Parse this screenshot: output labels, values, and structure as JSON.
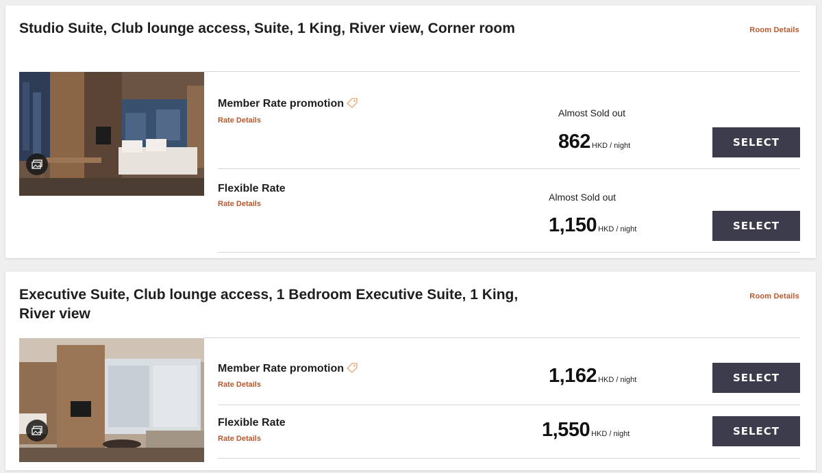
{
  "rooms": [
    {
      "title": "Studio Suite, Club lounge access, Suite, 1 King, River view, Corner room",
      "room_details_label": "Room Details",
      "rates": [
        {
          "name": "Member Rate promotion",
          "has_promo_tag": true,
          "rate_details_label": "Rate Details",
          "availability": "Almost Sold out",
          "price": "862",
          "unit": "HKD / night",
          "button_label": "SELECT"
        },
        {
          "name": "Flexible Rate",
          "has_promo_tag": false,
          "rate_details_label": "Rate Details",
          "availability": "Almost Sold out",
          "price": "1,150",
          "unit": "HKD / night",
          "button_label": "SELECT"
        }
      ]
    },
    {
      "title": "Executive Suite, Club lounge access, 1 Bedroom Executive Suite, 1 King, River view",
      "room_details_label": "Room Details",
      "rates": [
        {
          "name": "Member Rate promotion",
          "has_promo_tag": true,
          "rate_details_label": "Rate Details",
          "availability": "",
          "price": "1,162",
          "unit": "HKD / night",
          "button_label": "SELECT"
        },
        {
          "name": "Flexible Rate",
          "has_promo_tag": false,
          "rate_details_label": "Rate Details",
          "availability": "",
          "price": "1,550",
          "unit": "HKD / night",
          "button_label": "SELECT"
        }
      ]
    }
  ],
  "colors": {
    "accent": "#b8572b",
    "button_bg": "#3d3c4c",
    "page_bg": "#efefef",
    "promo_tag": "#e9a56b"
  },
  "icons": {
    "gallery": "photo-gallery-icon",
    "promo": "price-tag-icon"
  }
}
